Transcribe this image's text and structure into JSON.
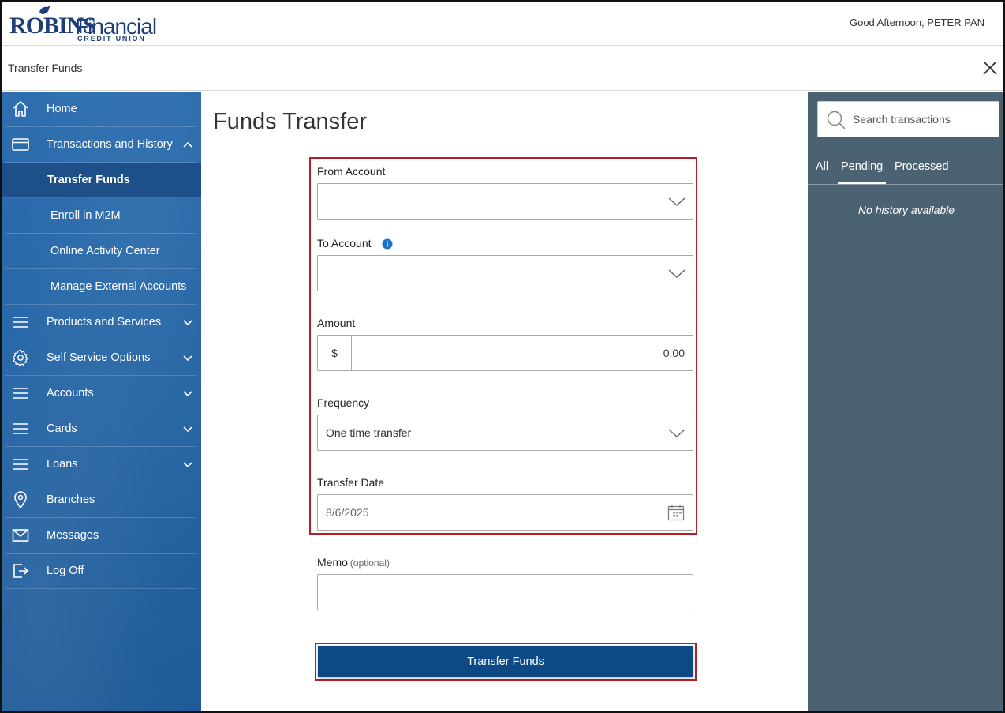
{
  "header": {
    "logo": {
      "robins": "ROBINS",
      "financial": "Financial",
      "credit_union": "CREDIT UNION"
    },
    "greeting": "Good Afternoon, PETER PAN"
  },
  "subheader": {
    "title": "Transfer Funds"
  },
  "sidebar": {
    "items": [
      {
        "label": "Home",
        "icon": "home-icon"
      },
      {
        "label": "Transactions and History",
        "icon": "credit-card-icon",
        "expanded": true
      },
      {
        "label": "Transfer Funds",
        "sub": true,
        "active": true
      },
      {
        "label": "Enroll in M2M",
        "sub": true
      },
      {
        "label": "Online Activity Center",
        "sub": true
      },
      {
        "label": "Manage External Accounts",
        "sub": true
      },
      {
        "label": "Products and Services",
        "icon": "menu-icon"
      },
      {
        "label": "Self Service Options",
        "icon": "gear-icon"
      },
      {
        "label": "Accounts",
        "icon": "menu-icon"
      },
      {
        "label": "Cards",
        "icon": "menu-icon"
      },
      {
        "label": "Loans",
        "icon": "menu-icon"
      },
      {
        "label": "Branches",
        "icon": "location-pin-icon"
      },
      {
        "label": "Messages",
        "icon": "envelope-icon"
      },
      {
        "label": "Log Off",
        "icon": "logout-icon"
      }
    ]
  },
  "main": {
    "title": "Funds Transfer",
    "from_account": {
      "label": "From Account",
      "value": ""
    },
    "to_account": {
      "label": "To Account",
      "value": ""
    },
    "amount": {
      "label": "Amount",
      "prefix": "$",
      "value": "0.00"
    },
    "frequency": {
      "label": "Frequency",
      "value": "One time transfer"
    },
    "transfer_date": {
      "label": "Transfer Date",
      "value": "8/6/2025"
    },
    "memo": {
      "label": "Memo",
      "optional": "(optional)",
      "value": ""
    },
    "submit_label": "Transfer Funds"
  },
  "right_panel": {
    "search_placeholder": "Search transactions",
    "tabs": [
      "All",
      "Pending",
      "Processed"
    ],
    "active_tab": "Pending",
    "empty_text": "No history available"
  },
  "colors": {
    "sidebar_bg": "#2565a6",
    "primary_button": "#0d4a85",
    "right_panel_bg": "#4b6273",
    "highlight_border": "#b3202a",
    "info_blue": "#1a73c8"
  }
}
